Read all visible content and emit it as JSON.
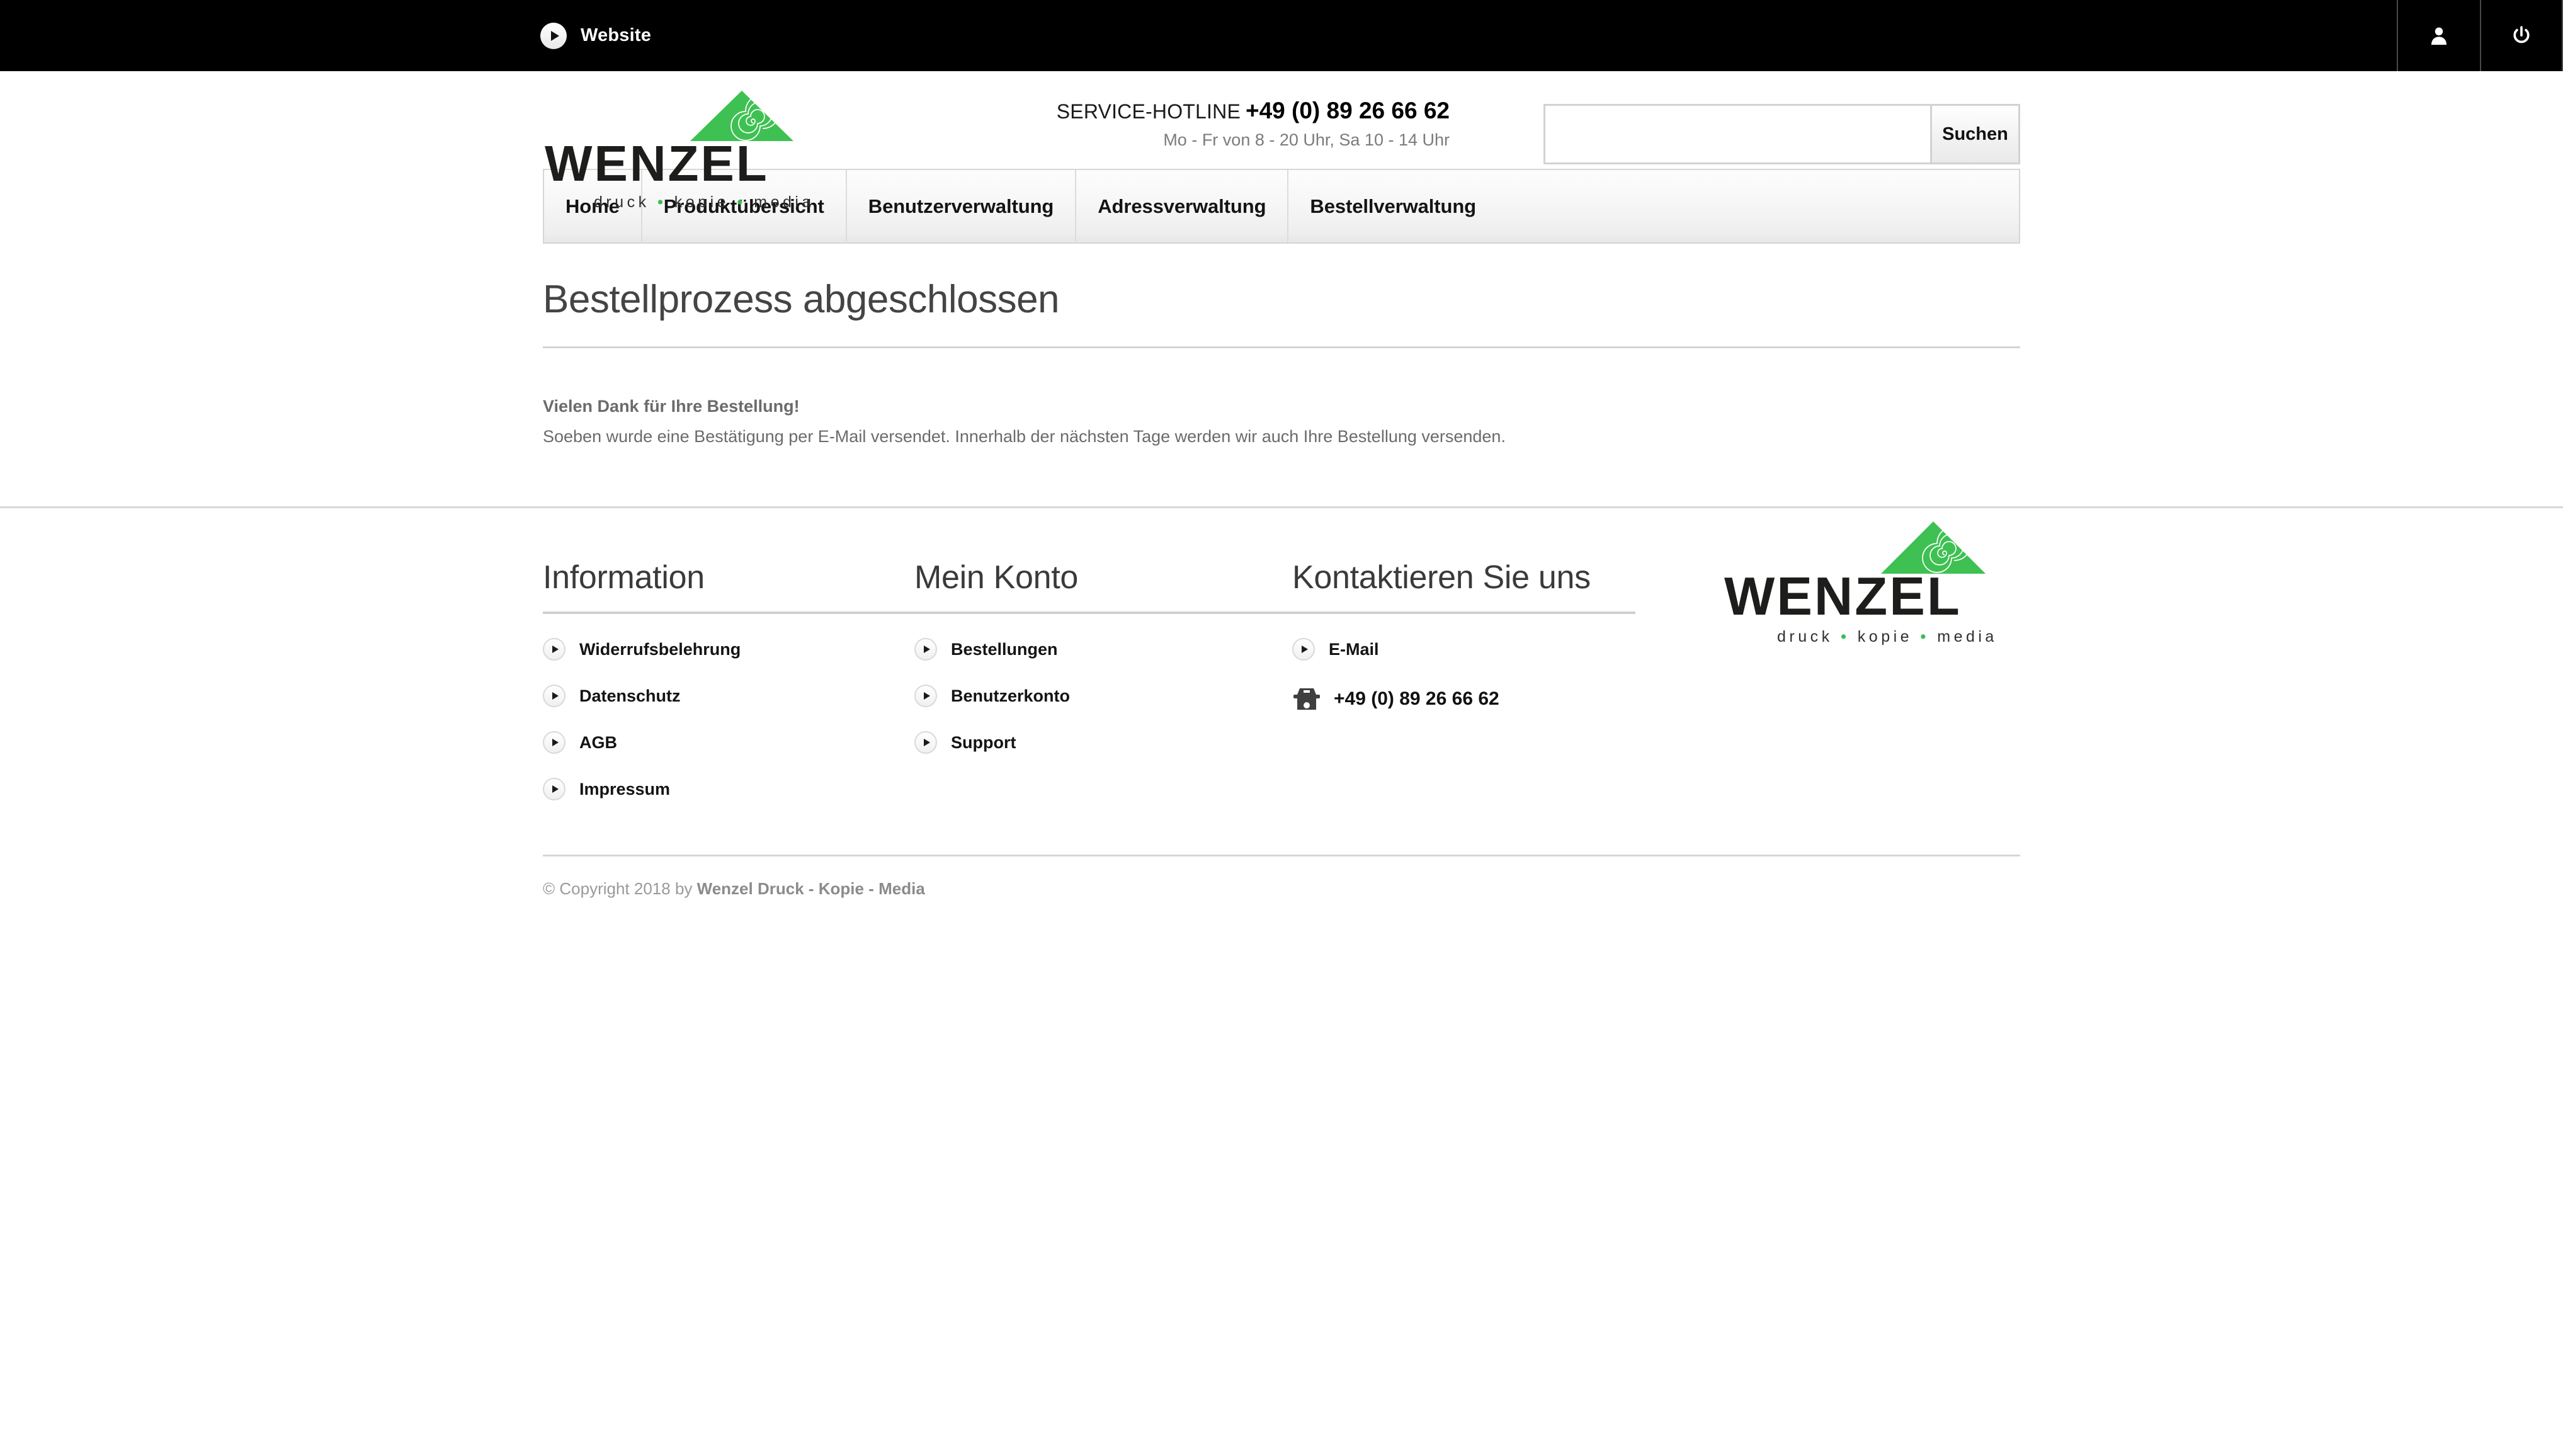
{
  "topbar": {
    "website_label": "Website",
    "play_icon": "play-circle-icon",
    "user_icon": "user-icon",
    "power_icon": "power-icon"
  },
  "header": {
    "logo": {
      "wordmark": "WENZEL",
      "tagline_parts": [
        "druck",
        "kopie",
        "media"
      ],
      "tagline": "druck • kopie • media",
      "triangle_color": "#3ec152",
      "word_color": "#1d1d1b"
    },
    "hotline": {
      "label": "SERVICE-HOTLINE",
      "number": "+49 (0) 89 26 66 62",
      "hours": "Mo - Fr von 8 - 20 Uhr, Sa 10 - 14 Uhr"
    },
    "search": {
      "value": "",
      "placeholder": "",
      "button_label": "Suchen"
    }
  },
  "nav": {
    "items": [
      {
        "label": "Home"
      },
      {
        "label": "Produktübersicht"
      },
      {
        "label": "Benutzerverwaltung"
      },
      {
        "label": "Adressverwaltung"
      },
      {
        "label": "Bestellverwaltung"
      }
    ]
  },
  "main": {
    "title": "Bestellprozess abgeschlossen",
    "thanks_heading": "Vielen Dank für Ihre Bestellung!",
    "thanks_body": "Soeben wurde eine Bestätigung per E-Mail versendet. Innerhalb der nächsten Tage werden wir auch Ihre Bestellung versenden."
  },
  "footer": {
    "columns": [
      {
        "heading": "Information",
        "links": [
          {
            "label": "Widerrufsbelehrung"
          },
          {
            "label": "Datenschutz"
          },
          {
            "label": "AGB"
          },
          {
            "label": "Impressum"
          }
        ]
      },
      {
        "heading": "Mein Konto",
        "links": [
          {
            "label": "Bestellungen"
          },
          {
            "label": "Benutzerkonto"
          },
          {
            "label": "Support"
          }
        ]
      },
      {
        "heading": "Kontaktieren Sie uns",
        "links": [
          {
            "label": "E-Mail"
          }
        ],
        "phone": "+49 (0) 89 26 66 62",
        "phone_icon": "telephone-icon"
      }
    ],
    "logo": {
      "wordmark": "WENZEL",
      "tagline": "druck • kopie • media"
    },
    "copyright_prefix": "© Copyright 2018 by ",
    "copyright_company": "Wenzel Druck - Kopie - Media"
  },
  "colors": {
    "brand_green": "#3ec152",
    "dark": "#1d1d1b",
    "muted_text": "#6b6b6b",
    "rule": "#d6d6d6"
  }
}
